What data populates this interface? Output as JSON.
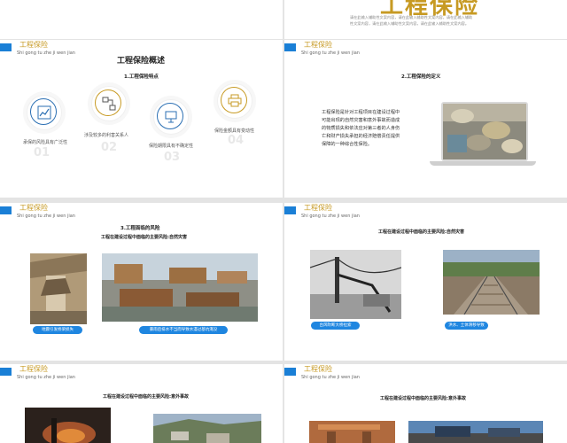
{
  "brand": {
    "title": "工程保险",
    "subtitle": "Shi gong tu zhe ji wen jian"
  },
  "top_slide": {
    "title": "工程保险",
    "desc1": "请在此输入辅助性文案内容，请在此输入辅助性文案内容，请在此输入辅助",
    "desc2": "性文案内容，请在此输入辅助性文案内容，请在此输入辅助性文案内容。"
  },
  "slide1": {
    "title": "工程保险概述",
    "section": "1.工程保险特点",
    "features": [
      {
        "label": "承保的风险具有广泛性",
        "num": "01"
      },
      {
        "label": "涉及较多的利害关系人",
        "num": "02"
      },
      {
        "label": "保险期限具有不确定性",
        "num": "03"
      },
      {
        "label": "保险金额具有变动性",
        "num": "04"
      }
    ]
  },
  "slide2": {
    "section": "2.工程保险的定义",
    "body": [
      "工程保险是针对工程项目在建设过程中",
      "可能出现的自然灾害和意外事故而造成",
      "的物质损失和依法应对第三者的人身伤",
      "亡和财产损失承担的经济赔偿责任提供",
      "保障的一种综合性保险。"
    ]
  },
  "slide3": {
    "section": "3.工程面临的风险",
    "heading": "工程在建设过程中面临的主要风险:自然灾害",
    "captions": [
      "地震引发桥梁损失",
      "暴雨后排水不当而导致水漫过基坑淹没"
    ]
  },
  "slide4": {
    "heading": "工程在建设过程中面临的主要风险:自然灾害",
    "captions": [
      "台风吹断大桥拉索",
      "洪水、土体滑移导致"
    ]
  },
  "slide5": {
    "heading": "工程在建设过程中面临的主要风险:意外事故"
  },
  "slide6": {
    "heading": "工程在建设过程中面临的主要风险:意外事故"
  },
  "colors": {
    "accent_blue": "#1a7fd6",
    "gold": "#c79a23"
  }
}
